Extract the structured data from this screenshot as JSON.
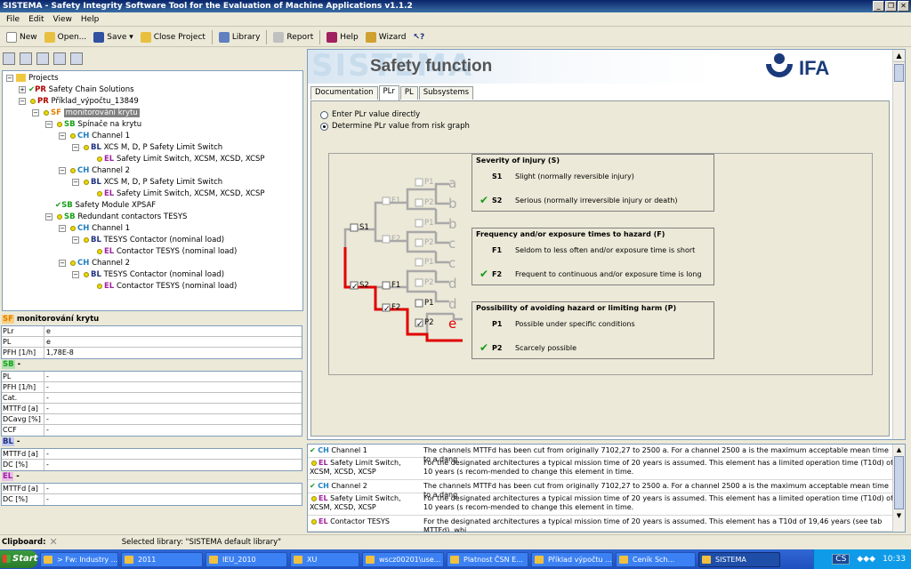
{
  "window": {
    "title": "SISTEMA - Safety Integrity Software Tool for the Evaluation of Machine Applications v1.1.2"
  },
  "menu": [
    "File",
    "Edit",
    "View",
    "Help"
  ],
  "toolbar": {
    "new": "New",
    "open": "Open...",
    "save": "Save",
    "close_project": "Close Project",
    "library": "Library",
    "report": "Report",
    "help": "Help",
    "wizard": "Wizard"
  },
  "tree": {
    "root": "Projects",
    "nodes": [
      {
        "tag": "PR",
        "label": "Safety Chain Solutions"
      },
      {
        "tag": "PR",
        "label": "Příklad_výpočtu_13849"
      },
      {
        "tag": "SF",
        "label": "monitorování krytu"
      },
      {
        "tag": "SB",
        "label": "Spínače na krytu"
      },
      {
        "tag": "CH",
        "label": "Channel 1"
      },
      {
        "tag": "BL",
        "label": "XCS M, D, P Safety Limit Switch"
      },
      {
        "tag": "EL",
        "label": "Safety Limit Switch,  XCSM, XCSD, XCSP"
      },
      {
        "tag": "CH",
        "label": "Channel 2"
      },
      {
        "tag": "BL",
        "label": "XCS M, D, P Safety Limit Switch"
      },
      {
        "tag": "EL",
        "label": "Safety Limit Switch,  XCSM, XCSD, XCSP"
      },
      {
        "tag": "SB",
        "label": "Safety Module XPSAF"
      },
      {
        "tag": "SB",
        "label": "Redundant contactors TESYS"
      },
      {
        "tag": "CH",
        "label": "Channel 1"
      },
      {
        "tag": "BL",
        "label": "TESYS Contactor (nominal load)"
      },
      {
        "tag": "EL",
        "label": "Contactor TESYS (nominal load)"
      },
      {
        "tag": "CH",
        "label": "Channel 2"
      },
      {
        "tag": "BL",
        "label": "TESYS Contactor (nominal load)"
      },
      {
        "tag": "EL",
        "label": "Contactor TESYS (nominal load)"
      }
    ]
  },
  "props": {
    "sf_title": "monitorování krytu",
    "sf_rows": [
      {
        "k": "PLr",
        "v": "e"
      },
      {
        "k": "PL",
        "v": "e"
      },
      {
        "k": "PFH [1/h]",
        "v": "1,78E-8"
      }
    ],
    "sb_title": "-",
    "sb_rows": [
      {
        "k": "PL",
        "v": "-"
      },
      {
        "k": "PFH [1/h]",
        "v": "-"
      },
      {
        "k": "Cat.",
        "v": "-"
      },
      {
        "k": "MTTFd [a]",
        "v": "-"
      },
      {
        "k": "DCavg [%]",
        "v": "-"
      },
      {
        "k": "CCF",
        "v": "-"
      }
    ],
    "bl_title": "-",
    "bl_rows": [
      {
        "k": "MTTFd [a]",
        "v": "-"
      },
      {
        "k": "DC [%]",
        "v": "-"
      }
    ],
    "el_title": "-",
    "el_rows": [
      {
        "k": "MTTFd [a]",
        "v": "-"
      },
      {
        "k": "DC [%]",
        "v": "-"
      }
    ]
  },
  "banner": {
    "watermark": "SISTEMA",
    "title": "Safety function",
    "logo": "IFA"
  },
  "tabs": [
    "Documentation",
    "PLr",
    "PL",
    "Subsystems"
  ],
  "radio": {
    "opt1": "Enter PLr value directly",
    "opt2": "Determine PLr value from risk graph"
  },
  "risk": {
    "severity": {
      "title": "Severity of injury (S)",
      "s1": "S1",
      "s1_text": "Slight (normally reversible injury)",
      "s2": "S2",
      "s2_text": "Serious (normally irreversible injury or death)"
    },
    "frequency": {
      "title": "Frequency and/or exposure times to hazard (F)",
      "f1": "F1",
      "f1_text": "Seldom to less often and/or exposure time is short",
      "f2": "F2",
      "f2_text": "Frequent to continuous and/or exposure time is long"
    },
    "possibility": {
      "title": "Possibility of avoiding hazard or limiting harm (P)",
      "p1": "P1",
      "p1_text": "Possible under specific conditions",
      "p2": "P2",
      "p2_text": "Scarcely possible"
    },
    "graph_labels": {
      "S1": "S1",
      "S2": "S2",
      "F1": "F1",
      "F2": "F2",
      "P1": "P1",
      "P2": "P2",
      "levels": [
        "a",
        "b",
        "b",
        "c",
        "c",
        "d",
        "d",
        "e"
      ]
    }
  },
  "messages": [
    {
      "tag": "CH",
      "name": "Channel 1",
      "text": "The channels MTTFd has been cut from originally 7102,27 to 2500 a. For a channel 2500 a is the maximum acceptable mean time to a dang"
    },
    {
      "tag": "EL",
      "name": "Safety Limit Switch,  XCSM, XCSD, XCSP",
      "text": "For the designated architectures a typical mission time of 20 years is assumed. This element has a limited operation time (T10d) of 10 years (s recom-mended to change this element in time."
    },
    {
      "tag": "CH",
      "name": "Channel 2",
      "text": "The channels MTTFd has been cut from originally 7102,27 to 2500 a. For a channel 2500 a is the maximum acceptable mean time to a dang"
    },
    {
      "tag": "EL",
      "name": "Safety Limit Switch,  XCSM, XCSD, XCSP",
      "text": "For the designated architectures a typical mission time of 20 years is assumed. This element has a limited operation time (T10d) of 10 years (s recom-mended to change this element in time."
    },
    {
      "tag": "EL",
      "name": "Contactor TESYS",
      "text": "For the designated architectures a typical mission time of 20 years is assumed. This element has a T10d of 19,46 years (see tab MTTFd), whi"
    }
  ],
  "status": {
    "clipboard": "Clipboard:",
    "library": "Selected library: \"SISTEMA default library\""
  },
  "taskbar": {
    "start": "Start",
    "tasks": [
      "> Fw: Industry ...",
      "2011",
      "IEU_2010",
      "XU",
      "wscz00201\\use...",
      "Platnost ČSN E...",
      "Příklad výpočtu ...",
      "Ceník Sch...",
      "SISTEMA"
    ],
    "lang": "CS",
    "clock": "10:33"
  },
  "colors": {
    "tree_sf": "#e08000",
    "tree_pr": "#b00000",
    "path_red": "#e00000",
    "check": "#1a9a1a"
  }
}
